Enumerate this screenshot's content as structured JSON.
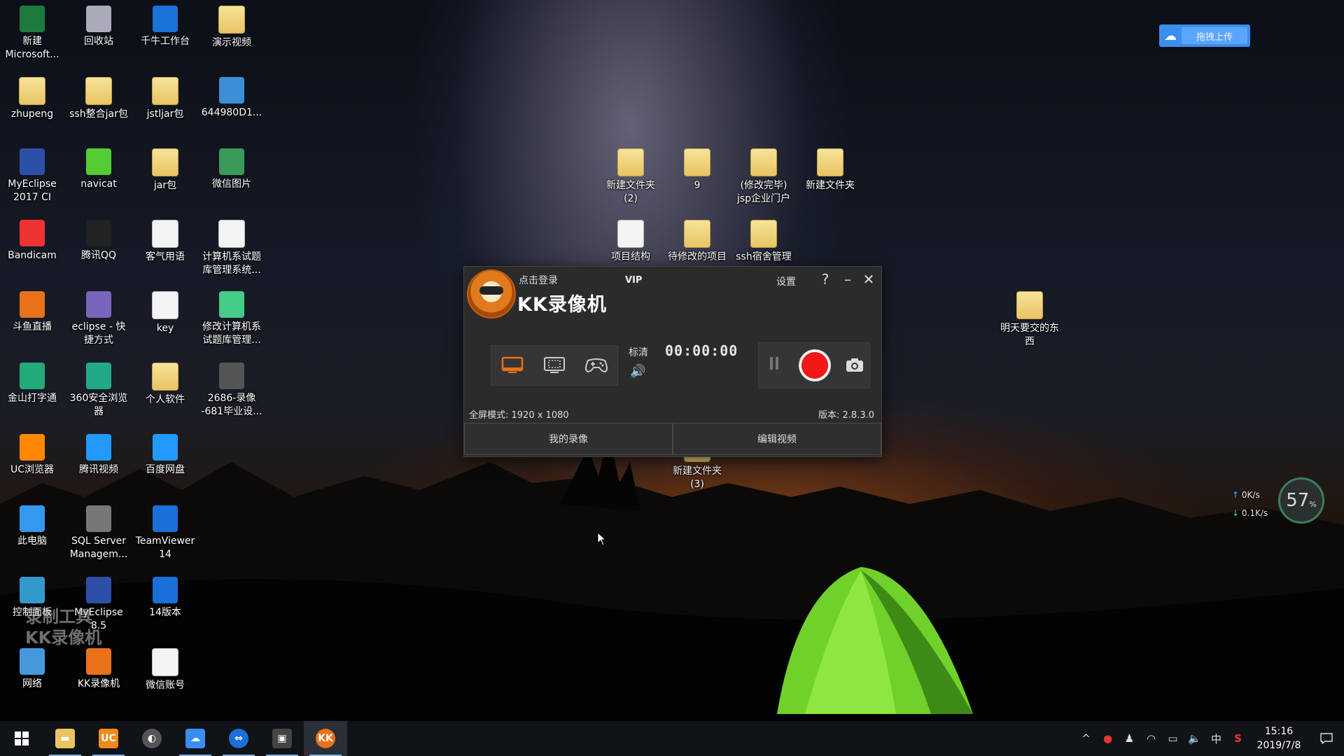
{
  "desktop": {
    "icons": [
      {
        "label": "新建\nMicrosoft..."
      },
      {
        "label": "回收站"
      },
      {
        "label": "千牛工作台"
      },
      {
        "label": "演示视频"
      },
      {
        "label": "zhupeng"
      },
      {
        "label": "ssh整合jar包"
      },
      {
        "label": "jstljar包"
      },
      {
        "label": "644980D1..."
      },
      {
        "label": "MyEclipse\n2017 CI"
      },
      {
        "label": "navicat"
      },
      {
        "label": "jar包"
      },
      {
        "label": "微信图片"
      },
      {
        "label": "Bandicam"
      },
      {
        "label": "腾讯QQ"
      },
      {
        "label": "客气用语"
      },
      {
        "label": "计算机系试题\n库管理系统..."
      },
      {
        "label": "斗鱼直播"
      },
      {
        "label": "eclipse - 快\n捷方式"
      },
      {
        "label": "key"
      },
      {
        "label": "修改计算机系\n试题库管理..."
      },
      {
        "label": "金山打字通"
      },
      {
        "label": "360安全浏览\n器"
      },
      {
        "label": "个人软件"
      },
      {
        "label": "2686-录像\n-681毕业设..."
      },
      {
        "label": "UC浏览器"
      },
      {
        "label": "腾讯视频"
      },
      {
        "label": "百度网盘"
      },
      {
        "label": "此电脑"
      },
      {
        "label": "SQL Server\nManagem..."
      },
      {
        "label": "TeamViewer\n14"
      },
      {
        "label": "控制面板"
      },
      {
        "label": "MyEclipse\n8.5"
      },
      {
        "label": "14版本"
      },
      {
        "label": "网络"
      },
      {
        "label": "KK录像机"
      },
      {
        "label": "微信账号"
      },
      {
        "label": "新建文件夹\n(2)"
      },
      {
        "label": "9"
      },
      {
        "label": "(修改完毕)\njsp企业门户"
      },
      {
        "label": "新建文件夹"
      },
      {
        "label": "项目结构"
      },
      {
        "label": "待修改的项目"
      },
      {
        "label": "ssh宿舍管理"
      },
      {
        "label": "明天要交的东\n西"
      },
      {
        "label": "新建文件夹\n(3)"
      }
    ]
  },
  "upload_widget": {
    "label": "拖拽上传",
    "icon": "baidu-netdisk-icon"
  },
  "kk_window": {
    "login": "点击登录",
    "vip": "VIP",
    "brand": "KK录像机",
    "settings": "设置",
    "help": "?",
    "minimize": "–",
    "close": "✕",
    "quality": "标清",
    "timer": "00:00:00",
    "mode_info": "全屏模式: 1920 x 1080",
    "version": "版本: 2.8.3.0",
    "my_recordings": "我的录像",
    "edit_video": "编辑视频",
    "modes": [
      "fullscreen-mode-icon",
      "region-mode-icon",
      "game-mode-icon"
    ],
    "accent": "#e8711a",
    "record_color": "#f01818"
  },
  "watermark": {
    "line1": "录制工具",
    "line2": "KK录像机"
  },
  "network_widget": {
    "upload": "0K/s",
    "download": "0.1K/s",
    "percent": "57",
    "unit": "%"
  },
  "taskbar": {
    "apps": [
      "start-icon",
      "file-explorer-icon",
      "uc-browser-icon",
      "eclipse-icon",
      "baidu-netdisk-icon",
      "teamviewer-icon",
      "video-editor-icon",
      "kk-recorder-icon"
    ],
    "tray_chevron": "^",
    "ime": "中",
    "time": "15:16",
    "date": "2019/7/8"
  }
}
